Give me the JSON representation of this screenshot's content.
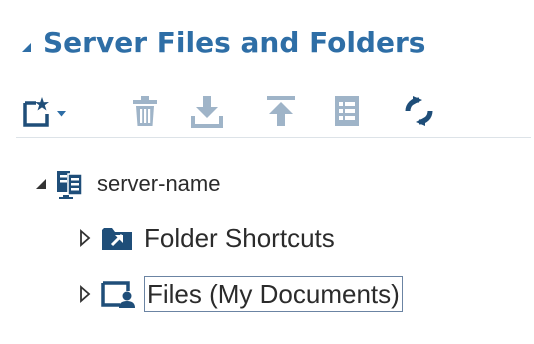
{
  "panel": {
    "title": "Server Files and Folders"
  },
  "toolbar": {
    "items": [
      {
        "icon": "new-item-icon",
        "has_dropdown": true,
        "enabled": true
      },
      {
        "icon": "trash-icon",
        "enabled": false
      },
      {
        "icon": "download-icon",
        "enabled": false
      },
      {
        "icon": "upload-icon",
        "enabled": false
      },
      {
        "icon": "properties-icon",
        "enabled": false
      },
      {
        "icon": "refresh-icon",
        "enabled": true
      }
    ]
  },
  "tree": {
    "server": {
      "label": "server-name",
      "expanded": true
    },
    "children": [
      {
        "label": "Folder Shortcuts",
        "icon": "folder-shortcut-icon",
        "expanded": false
      },
      {
        "label": "Files (My Documents)",
        "icon": "my-documents-icon",
        "expanded": false,
        "focused": true
      }
    ]
  },
  "colors": {
    "accent": "#2e6ea6",
    "icon_dark": "#1f4e79",
    "disabled": "#9fb4c8",
    "text": "#2b2b2b"
  }
}
